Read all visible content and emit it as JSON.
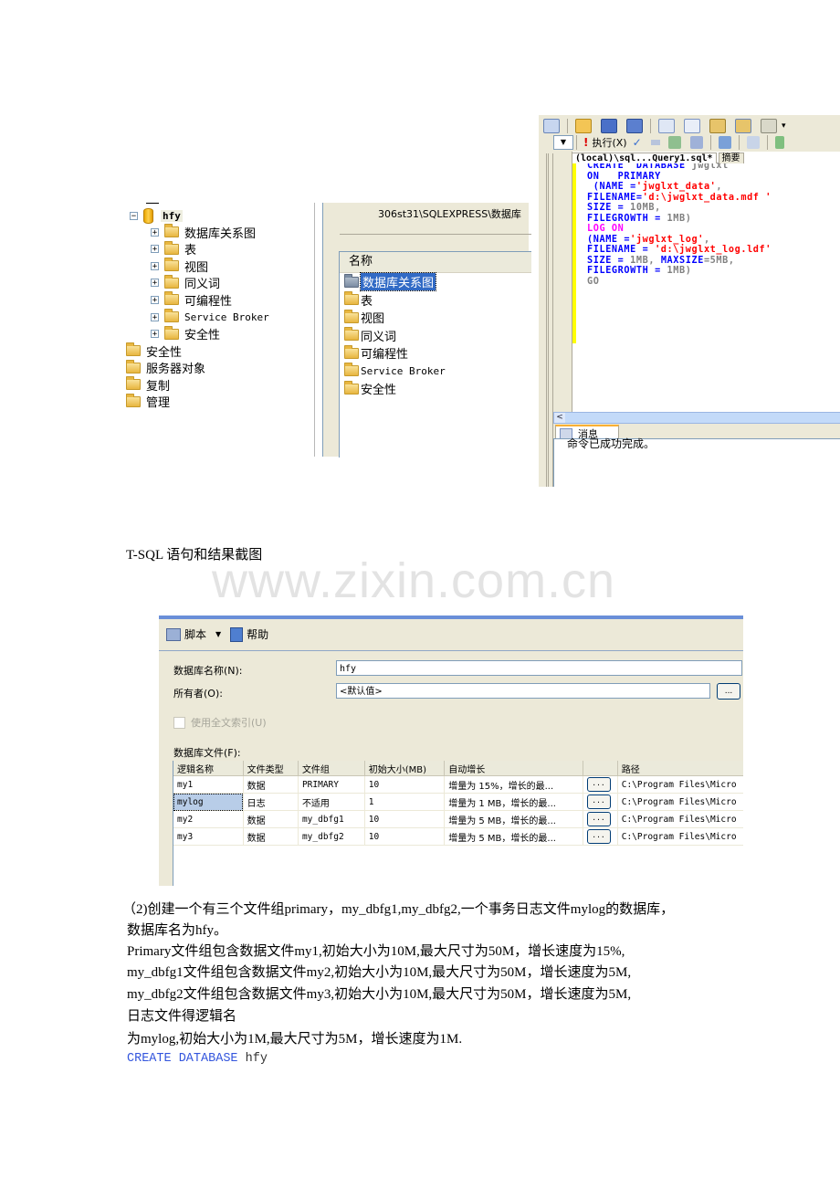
{
  "object_explorer": {
    "db_name": "hfy",
    "children": [
      {
        "label": "数据库关系图"
      },
      {
        "label": "表"
      },
      {
        "label": "视图"
      },
      {
        "label": "同义词"
      },
      {
        "label": "可编程性"
      },
      {
        "label": "Service Broker"
      },
      {
        "label": "安全性"
      }
    ],
    "top_level": [
      {
        "label": "安全性"
      },
      {
        "label": "服务器对象"
      },
      {
        "label": "复制"
      },
      {
        "label": "管理"
      }
    ],
    "expand_glyph": "+",
    "collapse_glyph": "−"
  },
  "summary_pane": {
    "path": "306st31\\SQLEXPRESS\\数据库",
    "column_header": "名称",
    "items": [
      {
        "label": "数据库关系图",
        "selected": true
      },
      {
        "label": "表"
      },
      {
        "label": "视图"
      },
      {
        "label": "同义词"
      },
      {
        "label": "可编程性"
      },
      {
        "label": "Service Broker"
      },
      {
        "label": "安全性"
      }
    ]
  },
  "query_window": {
    "execute_label": "执行(X)",
    "tabs": [
      "(local)\\sql...Query1.sql*",
      "摘要"
    ],
    "code_lines": [
      [
        {
          "t": "CREATE  DATABASE ",
          "c": "kw"
        },
        {
          "t": "jwglxt",
          "c": "gray"
        }
      ],
      [
        {
          "t": "ON   PRIMARY",
          "c": "kw"
        }
      ],
      [
        {
          "t": " (NAME =",
          "c": "kw"
        },
        {
          "t": "'jwglxt_data'",
          "c": "str"
        },
        {
          "t": ",",
          "c": "gray"
        }
      ],
      [
        {
          "t": "FILENAME=",
          "c": "kw"
        },
        {
          "t": "'d:\\jwglxt_data.mdf '",
          "c": "str"
        }
      ],
      [
        {
          "t": "SIZE = ",
          "c": "kw"
        },
        {
          "t": "10MB,",
          "c": "gray"
        }
      ],
      [
        {
          "t": "FILEGROWTH = ",
          "c": "kw"
        },
        {
          "t": "1MB)",
          "c": "gray"
        }
      ],
      [
        {
          "t": "LOG ON",
          "c": "pink"
        }
      ],
      [
        {
          "t": "(NAME =",
          "c": "kw"
        },
        {
          "t": "'jwglxt_log'",
          "c": "str"
        },
        {
          "t": ",",
          "c": "gray"
        }
      ],
      [
        {
          "t": "FILENAME = ",
          "c": "kw"
        },
        {
          "t": "'d:\\jwglxt_log.ldf'",
          "c": "str"
        }
      ],
      [
        {
          "t": "SIZE = ",
          "c": "kw"
        },
        {
          "t": "1MB, ",
          "c": "gray"
        },
        {
          "t": "MAXSIZE",
          "c": "kw"
        },
        {
          "t": "=5MB,",
          "c": "gray"
        }
      ],
      [
        {
          "t": "FILEGROWTH = ",
          "c": "kw"
        },
        {
          "t": "1MB)",
          "c": "gray"
        }
      ],
      [
        {
          "t": "GO",
          "c": "gray"
        }
      ]
    ],
    "messages_tab": "消息",
    "message": "命令已成功完成。"
  },
  "caption": "T-SQL 语句和结果截图",
  "watermark": "www.zixin.com.cn",
  "new_db_dialog": {
    "toolbar": {
      "script_label": "脚本",
      "help_label": "帮助"
    },
    "db_name_label": "数据库名称(N):",
    "db_name_value": "hfy",
    "owner_label": "所有者(O):",
    "owner_value": "<默认值>",
    "fulltext_label": "使用全文索引(U)",
    "fulltext_checked": false,
    "files_label": "数据库文件(F):",
    "browse_label": "...",
    "columns": [
      "逻辑名称",
      "文件类型",
      "文件组",
      "初始大小(MB)",
      "自动增长",
      "",
      "路径"
    ],
    "rows": [
      {
        "name": "my1",
        "type": "数据",
        "filegroup": "PRIMARY",
        "size": "10",
        "growth": "增量为 15%，增长的最...",
        "path": "C:\\Program Files\\Micro"
      },
      {
        "name": "mylog",
        "type": "日志",
        "filegroup": "不适用",
        "size": "1",
        "growth": "增量为 1 MB，增长的最...",
        "path": "C:\\Program Files\\Micro",
        "selected": true
      },
      {
        "name": "my2",
        "type": "数据",
        "filegroup": "my_dbfg1",
        "size": "10",
        "growth": "增量为 5 MB，增长的最...",
        "path": "C:\\Program Files\\Micro"
      },
      {
        "name": "my3",
        "type": "数据",
        "filegroup": "my_dbfg2",
        "size": "10",
        "growth": "增量为 5 MB，增长的最...",
        "path": "C:\\Program Files\\Micro"
      }
    ]
  },
  "document_text": [
    "（2)创建一个有三个文件组primary，my_dbfg1,my_dbfg2,一个事务日志文件mylog的数据库，",
    "数据库名为hfy。",
    "Primary文件组包含数据文件my1,初始大小为10M,最大尺寸为50M，增长速度为15%,",
    "my_dbfg1文件组包含数据文件my2,初始大小为10M,最大尺寸为50M，增长速度为5M,",
    "my_dbfg2文件组包含数据文件my3,初始大小为10M,最大尺寸为50M，增长速度为5M,",
    "日志文件得逻辑名",
    "为mylog,初始大小为1M,最大尺寸为5M，增长速度为1M."
  ],
  "code_footer": {
    "keyword": "CREATE DATABASE",
    "name": "hfy"
  }
}
